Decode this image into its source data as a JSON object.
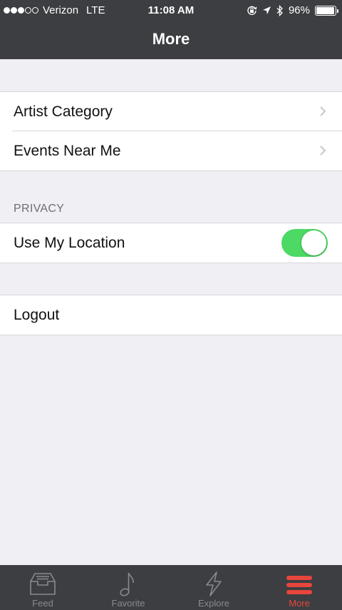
{
  "status_bar": {
    "carrier": "Verizon",
    "network": "LTE",
    "time": "11:08 AM",
    "battery_text": "96%",
    "battery_level": 0.96
  },
  "nav": {
    "title": "More"
  },
  "sections": {
    "general": {
      "rows": [
        {
          "label": "Artist Category"
        },
        {
          "label": "Events Near Me"
        }
      ]
    },
    "privacy": {
      "header": "PRIVACY",
      "use_location": {
        "label": "Use My Location",
        "enabled": true
      }
    },
    "account": {
      "logout": {
        "label": "Logout"
      }
    }
  },
  "tabbar": {
    "tabs": [
      {
        "label": "Feed",
        "icon": "inbox-tray-icon"
      },
      {
        "label": "Favorite",
        "icon": "music-note-icon"
      },
      {
        "label": "Explore",
        "icon": "lightning-bolt-icon"
      },
      {
        "label": "More",
        "icon": "hamburger-menu-icon"
      }
    ],
    "active_index": 3
  },
  "colors": {
    "nav_background": "#3d3e42",
    "toggle_on": "#4cd964",
    "active_tab": "#e8453c",
    "inactive_tab": "#8a8a8e",
    "page_background": "#efeff4"
  }
}
